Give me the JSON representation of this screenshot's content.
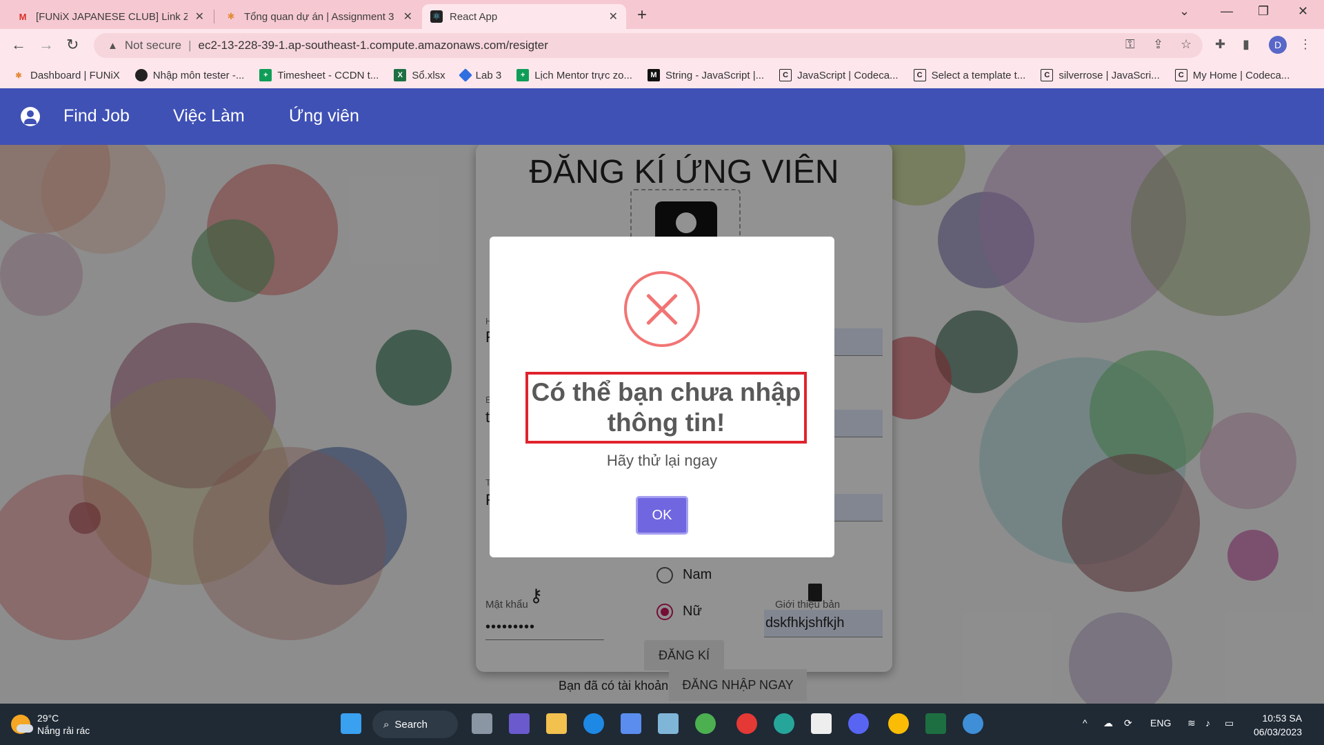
{
  "browser": {
    "tabs": [
      {
        "title": "[FUNiX JAPANESE CLUB] Link Zoo",
        "icon": "gmail-icon"
      },
      {
        "title": "Tổng quan dự án | Assignment 3",
        "icon": "funix-icon"
      },
      {
        "title": "React App",
        "icon": "react-icon"
      }
    ],
    "address": {
      "security": "Not secure",
      "url": "ec2-13-228-39-1.ap-southeast-1.compute.amazonaws.com/resigter"
    },
    "profile_initial": "D",
    "bookmarks": [
      "Dashboard | FUNiX",
      "Nhập môn tester -...",
      "Timesheet - CCDN t...",
      "Sổ.xlsx",
      "Lab 3",
      "Lịch Mentor trực zo...",
      "String - JavaScript |...",
      "JavaScript | Codeca...",
      "Select a template t...",
      "silverrose | JavaScri...",
      "My Home | Codeca..."
    ]
  },
  "navbar": {
    "brand": "Find Job",
    "links": [
      "Việc Làm",
      "Ứng viên"
    ]
  },
  "form": {
    "title": "ĐĂNG KÍ ỨNG VIÊN",
    "frag_h": "H",
    "frag_1": "F",
    "frag_e": "E",
    "frag_2": "t",
    "frag_t": "T",
    "frag_3": "F",
    "password_label": "Mật khẩu",
    "password_value": "•••••••••",
    "gender_options": [
      "Nam",
      "Nữ"
    ],
    "gender_selected": "Nữ",
    "intro_label": "Giới thiệu bản",
    "intro_value": "dskfhkjshfkjh",
    "submit": "ĐĂNG KÍ",
    "have_account": "Bạn đã có tài khoản",
    "login_now": "ĐĂNG NHẬP NGAY"
  },
  "modal": {
    "title": "Có thể bạn chưa nhập thông tin!",
    "text": "Hãy thử lại ngay",
    "ok": "OK"
  },
  "taskbar": {
    "temp": "29°C",
    "weather": "Nắng rải rác",
    "search": "Search",
    "lang": "ENG",
    "time": "10:53 SA",
    "date": "06/03/2023"
  },
  "colors": {
    "navbar": "#3f51b5",
    "modal_ok": "#7066e0",
    "error": "#f27474",
    "highlight_box": "#e0232d"
  }
}
